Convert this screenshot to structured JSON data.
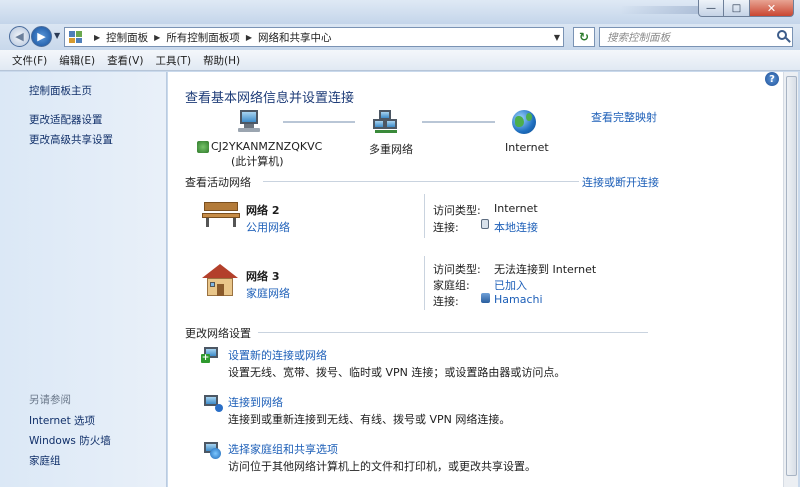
{
  "window": {
    "minimize": "—",
    "maximize": "□",
    "close": "✕"
  },
  "address": {
    "crumbs": [
      "控制面板",
      "所有控制面板项",
      "网络和共享中心"
    ]
  },
  "search": {
    "placeholder": "搜索控制面板"
  },
  "menu": [
    "文件(F)",
    "编辑(E)",
    "查看(V)",
    "工具(T)",
    "帮助(H)"
  ],
  "sidebar": {
    "links": [
      "控制面板主页",
      "更改适配器设置",
      "更改高级共享设置"
    ],
    "see_also_heading": "另请参阅",
    "see_also": [
      "Internet 选项",
      "Windows 防火墙",
      "家庭组"
    ]
  },
  "main": {
    "title": "查看基本网络信息并设置连接",
    "full_map_link": "查看完整映射",
    "map": {
      "computer_name": "CJ2YKANMZNZQKVC",
      "computer_sub": "(此计算机)",
      "middle": "多重网络",
      "end": "Internet"
    },
    "active_heading": "查看活动网络",
    "connect_disconnect": "连接或断开连接",
    "networks": [
      {
        "name": "网络  2",
        "type": "公用网络",
        "access_label": "访问类型:",
        "access_value": "Internet",
        "conn_label": "连接:",
        "conn_value": "本地连接"
      },
      {
        "name": "网络  3",
        "type": "家庭网络",
        "access_label": "访问类型:",
        "access_value": "无法连接到 Internet",
        "homegroup_label": "家庭组:",
        "homegroup_value": "已加入",
        "conn_label": "连接:",
        "conn_value": "Hamachi"
      }
    ],
    "change_heading": "更改网络设置",
    "tasks": [
      {
        "title": "设置新的连接或网络",
        "desc": "设置无线、宽带、拨号、临时或 VPN 连接；或设置路由器或访问点。"
      },
      {
        "title": "连接到网络",
        "desc": "连接到或重新连接到无线、有线、拨号或 VPN 网络连接。"
      },
      {
        "title": "选择家庭组和共享选项",
        "desc": "访问位于其他网络计算机上的文件和打印机，或更改共享设置。"
      }
    ]
  }
}
